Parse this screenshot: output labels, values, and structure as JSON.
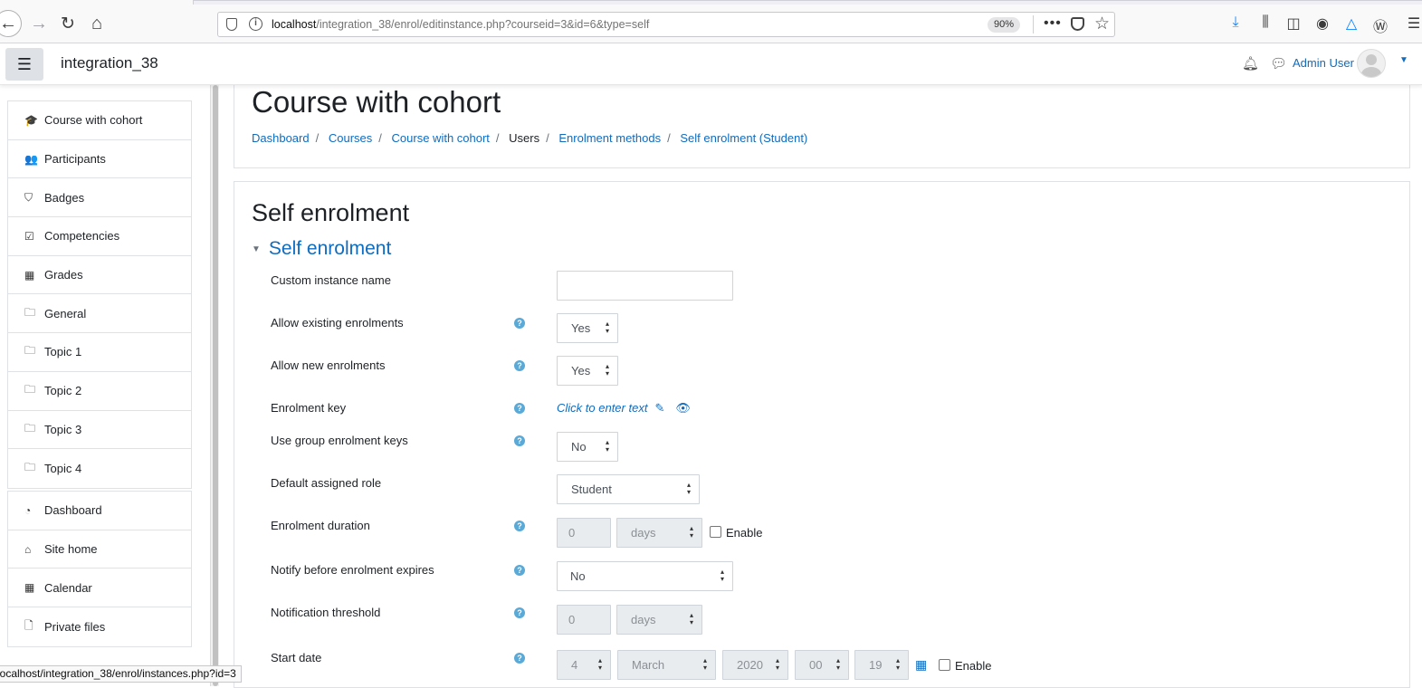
{
  "browser": {
    "url_host": "localhost",
    "url_path": "/integration_38/enrol/editinstance.php?courseid=3&id=6&type=self",
    "zoom": "90%",
    "status_url": "localhost/integration_38/enrol/instances.php?id=3"
  },
  "navbar": {
    "site_name": "integration_38",
    "user_name": "Admin User"
  },
  "sidebar": {
    "course_items": [
      {
        "label": "Course with cohort",
        "icon": "graduation-cap-icon",
        "glyph": "🎓"
      },
      {
        "label": "Participants",
        "icon": "users-icon",
        "glyph": "👥"
      },
      {
        "label": "Badges",
        "icon": "shield-icon",
        "glyph": "⛉"
      },
      {
        "label": "Competencies",
        "icon": "check-square-icon",
        "glyph": "☑"
      },
      {
        "label": "Grades",
        "icon": "table-icon",
        "glyph": "▦"
      },
      {
        "label": "General",
        "icon": "folder-icon",
        "glyph": "🗀"
      },
      {
        "label": "Topic 1",
        "icon": "folder-icon",
        "glyph": "🗀"
      },
      {
        "label": "Topic 2",
        "icon": "folder-icon",
        "glyph": "🗀"
      },
      {
        "label": "Topic 3",
        "icon": "folder-icon",
        "glyph": "🗀"
      },
      {
        "label": "Topic 4",
        "icon": "folder-icon",
        "glyph": "🗀"
      }
    ],
    "site_items": [
      {
        "label": "Dashboard",
        "icon": "tachometer-icon",
        "glyph": "◔"
      },
      {
        "label": "Site home",
        "icon": "home-icon",
        "glyph": "⌂"
      },
      {
        "label": "Calendar",
        "icon": "calendar-icon",
        "glyph": "▦"
      },
      {
        "label": "Private files",
        "icon": "file-icon",
        "glyph": "🗋"
      }
    ]
  },
  "header": {
    "title": "Course with cohort",
    "breadcrumb": [
      "Dashboard",
      "Courses",
      "Course with cohort",
      "Users",
      "Enrolment methods",
      "Self enrolment (Student)"
    ]
  },
  "form": {
    "heading": "Self enrolment",
    "section": "Self enrolment",
    "fields": {
      "custom_name": {
        "label": "Custom instance name",
        "value": ""
      },
      "allow_existing": {
        "label": "Allow existing enrolments",
        "value": "Yes"
      },
      "allow_new": {
        "label": "Allow new enrolments",
        "value": "Yes"
      },
      "enrolment_key": {
        "label": "Enrolment key",
        "value": "Click to enter text"
      },
      "group_keys": {
        "label": "Use group enrolment keys",
        "value": "No"
      },
      "default_role": {
        "label": "Default assigned role",
        "value": "Student"
      },
      "duration": {
        "label": "Enrolment duration",
        "number": "0",
        "unit": "days",
        "enable": "Enable"
      },
      "notify": {
        "label": "Notify before enrolment expires",
        "value": "No"
      },
      "threshold": {
        "label": "Notification threshold",
        "number": "0",
        "unit": "days"
      },
      "start_date": {
        "label": "Start date",
        "day": "4",
        "month": "March",
        "year": "2020",
        "hour": "00",
        "minute": "19",
        "enable": "Enable"
      }
    }
  }
}
